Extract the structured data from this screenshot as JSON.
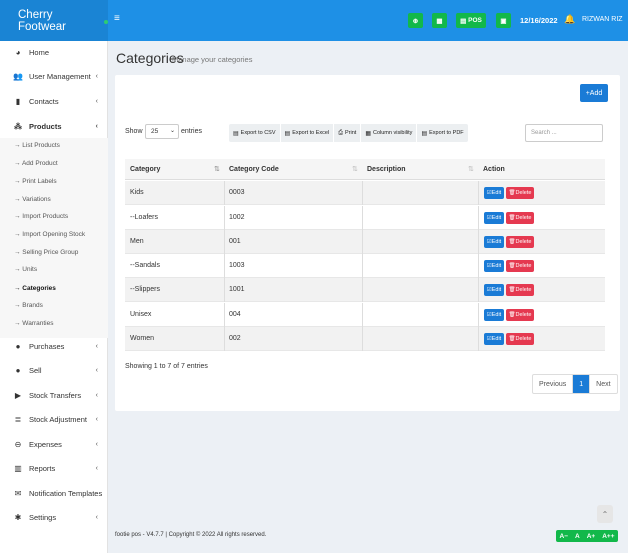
{
  "brand": {
    "name": "Cherry Footwear"
  },
  "header": {
    "menu_icon": "hamburger-icon",
    "pos_label": "POS",
    "date": "12/16/2022",
    "user": "RIZWAN RIZ"
  },
  "sidebar": {
    "items": [
      {
        "label": "Home",
        "icon": "dashboard-icon"
      },
      {
        "label": "User Management",
        "icon": "users-icon"
      },
      {
        "label": "Contacts",
        "icon": "address-book-icon"
      },
      {
        "label": "Products",
        "icon": "cubes-icon"
      },
      {
        "label": "Purchases",
        "icon": "arrow-circle-down-icon"
      },
      {
        "label": "Sell",
        "icon": "arrow-circle-up-icon"
      },
      {
        "label": "Stock Transfers",
        "icon": "truck-icon"
      },
      {
        "label": "Stock Adjustment",
        "icon": "database-icon"
      },
      {
        "label": "Expenses",
        "icon": "minus-circle-icon"
      },
      {
        "label": "Reports",
        "icon": "chart-icon"
      },
      {
        "label": "Notification Templates",
        "icon": "envelope-icon"
      },
      {
        "label": "Settings",
        "icon": "cog-icon"
      }
    ],
    "product_sub": [
      "→ List Products",
      "→ Add Product",
      "→ Print Labels",
      "→ Variations",
      "→ Import Products",
      "→ Import Opening Stock",
      "→ Selling Price Group",
      "→ Units",
      "→ Categories",
      "→ Brands",
      "→ Warranties"
    ]
  },
  "page": {
    "title": "Categories",
    "subtitle": "Manage your categories",
    "add_label": "+Add",
    "show_label": "Show",
    "show_value": "25",
    "entries_label": "entries",
    "search_placeholder": "Search ...",
    "showing_text": "Showing 1 to 7 of 7 entries",
    "footer": "footie pos - V4.7.7 | Copyright © 2022 All rights reserved."
  },
  "exports": [
    "Export to CSV",
    "Export to Excel",
    "Print",
    "Column visibility",
    "Export to PDF"
  ],
  "table": {
    "headers": [
      "Category",
      "Category Code",
      "Description",
      "Action"
    ],
    "rows": [
      {
        "category": "Kids",
        "code": "0003",
        "description": ""
      },
      {
        "category": "--Loafers",
        "code": "1002",
        "description": ""
      },
      {
        "category": "Men",
        "code": "001",
        "description": ""
      },
      {
        "category": "--Sandals",
        "code": "1003",
        "description": ""
      },
      {
        "category": "--Slippers",
        "code": "1001",
        "description": ""
      },
      {
        "category": "Unisex",
        "code": "004",
        "description": ""
      },
      {
        "category": "Women",
        "code": "002",
        "description": ""
      }
    ],
    "edit_label": "Edit",
    "delete_label": "Delete"
  },
  "pagination": {
    "previous": "Previous",
    "current": "1",
    "next": "Next"
  },
  "font_tools": [
    "A−",
    "A",
    "A+",
    "A++"
  ],
  "colors": {
    "primary": "#1e90e6",
    "success": "#12b84a",
    "danger": "#e53950"
  }
}
